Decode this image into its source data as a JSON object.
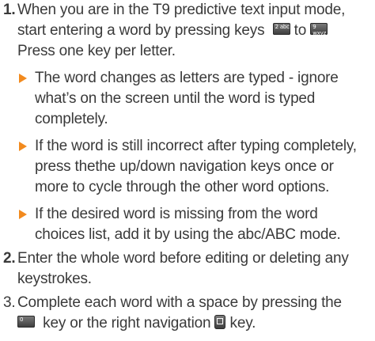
{
  "step1": {
    "number": "1.",
    "line1": "When you are in the T9 predictive text input mode,",
    "line2_a": "start entering a word by pressing keys",
    "key_from_glyph": "2 abc",
    "line2_b": "to",
    "key_to_glyph": "9 wxyz",
    "line3": "Press one key per letter."
  },
  "bullets": [
    {
      "lines": [
        "The word changes as letters are typed - ignore",
        "what’s on the screen until the word is typed",
        "completely."
      ]
    },
    {
      "lines": [
        "If the word is still incorrect after typing completely,",
        "press thethe up/down navigation keys once or",
        "more to cycle through the other word options."
      ]
    },
    {
      "lines": [
        "If the desired word is missing from the word",
        "choices list, add it by using the abc/ABC mode."
      ]
    }
  ],
  "step2": {
    "number": "2.",
    "line1": "Enter the whole word before editing or deleting any",
    "line2": "keystrokes."
  },
  "step3": {
    "number": "3.",
    "line1": "Complete each word with a space by pressing the",
    "key_space_glyph": "0",
    "line2_a": "key or the right navigation",
    "key_nav_glyph": "nav-right",
    "line2_b": "key."
  },
  "colors": {
    "text": "#3a3a3a",
    "bullet_arrow": "#f28a1e",
    "key_face": "#4a4a4a"
  }
}
